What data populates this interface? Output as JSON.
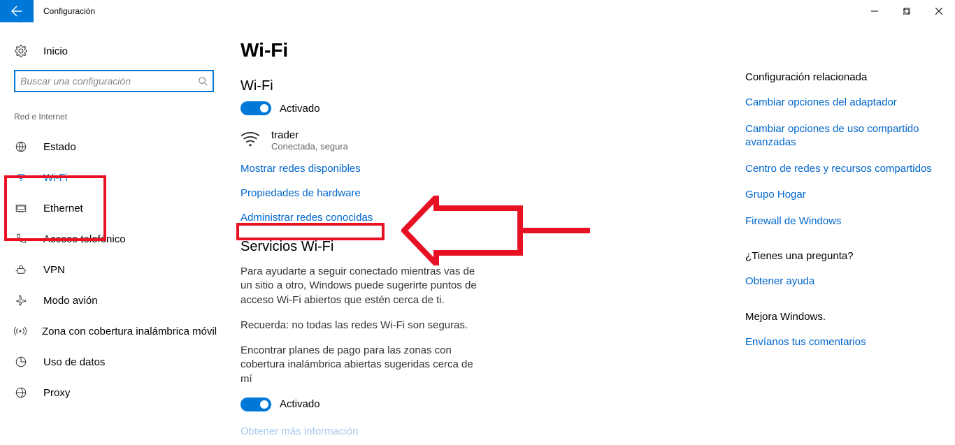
{
  "titlebar": {
    "title": "Configuración"
  },
  "sidebar": {
    "home": "Inicio",
    "search_placeholder": "Buscar una configuración",
    "section": "Red e Internet",
    "items": [
      {
        "label": "Estado"
      },
      {
        "label": "Wi-Fi"
      },
      {
        "label": "Ethernet"
      },
      {
        "label": "Acceso telefónico"
      },
      {
        "label": "VPN"
      },
      {
        "label": "Modo avión"
      },
      {
        "label": "Zona con cobertura inalámbrica móvil"
      },
      {
        "label": "Uso de datos"
      },
      {
        "label": "Proxy"
      }
    ]
  },
  "main": {
    "title": "Wi-Fi",
    "wifi_heading": "Wi-Fi",
    "toggle1_state": "Activado",
    "network": {
      "name": "trader",
      "status": "Conectada, segura"
    },
    "links": {
      "show_networks": "Mostrar redes disponibles",
      "hw_props": "Propiedades de hardware",
      "manage_known": "Administrar redes conocidas"
    },
    "services_heading": "Servicios Wi-Fi",
    "services_body1": "Para ayudarte a seguir conectado mientras vas de un sitio a otro, Windows puede sugerirte puntos de acceso Wi-Fi abiertos que estén cerca de ti.",
    "services_body2": "Recuerda: no todas las redes Wi-Fi son seguras.",
    "services_body3": "Encontrar planes de pago para las zonas con cobertura inalámbrica abiertas sugeridas cerca de mí",
    "toggle2_state": "Activado",
    "more_info": "Obtener más información"
  },
  "right": {
    "related_heading": "Configuración relacionada",
    "links": [
      "Cambiar opciones del adaptador",
      "Cambiar opciones de uso compartido avanzadas",
      "Centro de redes y recursos compartidos",
      "Grupo Hogar",
      "Firewall de Windows"
    ],
    "question_heading": "¿Tienes una pregunta?",
    "help_link": "Obtener ayuda",
    "improve_heading": "Mejora Windows.",
    "feedback_link": "Envíanos tus comentarios"
  }
}
